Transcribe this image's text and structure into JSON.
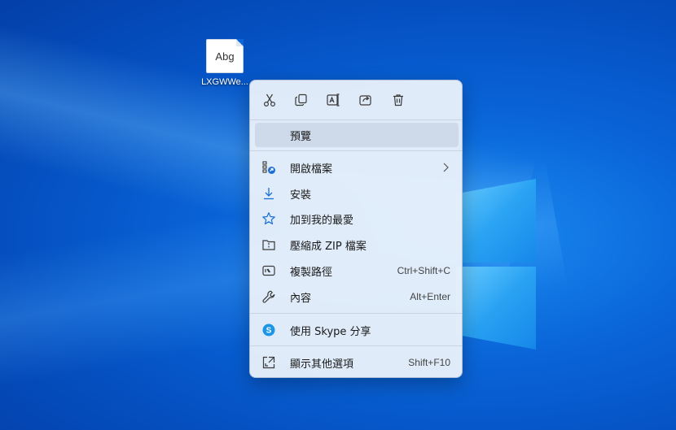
{
  "desktop": {
    "file_icon": {
      "thumbnail_text": "Abg",
      "label": "LXGWWe..."
    }
  },
  "context_menu": {
    "toolbar": [
      {
        "icon": "cut-icon",
        "action": "cut"
      },
      {
        "icon": "copy-icon",
        "action": "copy"
      },
      {
        "icon": "rename-icon",
        "action": "rename"
      },
      {
        "icon": "share-icon",
        "action": "share"
      },
      {
        "icon": "delete-icon",
        "action": "delete"
      }
    ],
    "items": {
      "preview": {
        "label": "預覽"
      },
      "open_with": {
        "label": "開啟檔案",
        "icon": "open-with-icon",
        "has_submenu": true
      },
      "install": {
        "label": "安裝",
        "icon": "download-icon"
      },
      "favorite": {
        "label": "加到我的最愛",
        "icon": "star-icon"
      },
      "compress": {
        "label": "壓縮成 ZIP 檔案",
        "icon": "zip-folder-icon"
      },
      "copy_path": {
        "label": "複製路徑",
        "icon": "copy-path-icon",
        "shortcut": "Ctrl+Shift+C"
      },
      "properties": {
        "label": "內容",
        "icon": "wrench-icon",
        "shortcut": "Alt+Enter"
      },
      "skype": {
        "label": "使用 Skype 分享",
        "icon": "skype-icon"
      },
      "more": {
        "label": "顯示其他選項",
        "icon": "more-options-icon",
        "shortcut": "Shift+F10"
      }
    }
  },
  "colors": {
    "accent": "#0a66d9",
    "skype": "#1a95e8",
    "menu_bg": "#e8f0fa"
  }
}
